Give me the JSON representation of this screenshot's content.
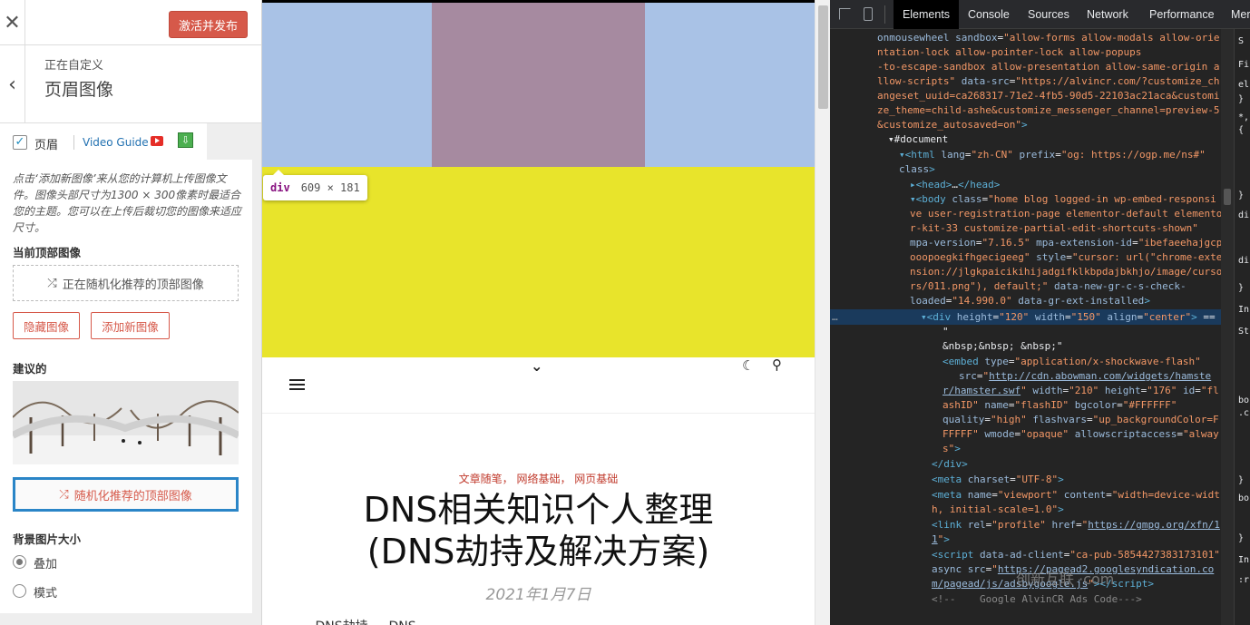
{
  "customizer": {
    "close_icon": "✕",
    "publish_label": "激活并发布",
    "back_icon": "‹",
    "subtitle": "正在自定义",
    "title": "页眉图像",
    "tab": {
      "checkbox_label": "页眉",
      "video_guide_label": "Video Guide"
    },
    "description": "点击‘添加新图像’来从您的计算机上传图像文件。图像头部尺寸为1300 × 300像素时最适合您的主题。您可以在上传后裁切您的图像来适应尺寸。",
    "current_header_heading": "当前顶部图像",
    "current_header_box": "正在随机化推荐的顶部图像",
    "hide_image_label": "隐藏图像",
    "add_image_label": "添加新图像",
    "suggested_heading": "建议的",
    "randomize_label": "随机化推荐的顶部图像",
    "bg_size_heading": "背景图片大小",
    "bg_options": [
      {
        "label": "叠加",
        "selected": true
      },
      {
        "label": "模式",
        "selected": false
      }
    ]
  },
  "preview": {
    "tooltip_tag": "div",
    "tooltip_size": "609 × 181",
    "categories": "文章随笔，  网络基础，  网页基础",
    "title_line1": "DNS相关知识个人整理",
    "title_line2": "(DNS劫持及解决方案)",
    "date": "2021年1月7日",
    "excerpt": "… DNS劫持 … DNS …",
    "colors": {
      "sky": "#a9c2e6",
      "block": "#a68aa0",
      "yellow": "#e8e42b",
      "accent": "#d6594a"
    }
  },
  "devtools": {
    "tabs": [
      "Elements",
      "Console",
      "Sources",
      "Network",
      "Performance",
      "Mer"
    ],
    "active_tab": "Elements",
    "side_labels": [
      "S",
      "Fi",
      "el",
      "}",
      "*,",
      "{",
      "}",
      "di",
      "di",
      "}",
      "In",
      "St",
      "bo",
      ".c",
      "}",
      "bo",
      "}",
      "In",
      ":r"
    ],
    "watermark": "创新互联 ·com"
  }
}
